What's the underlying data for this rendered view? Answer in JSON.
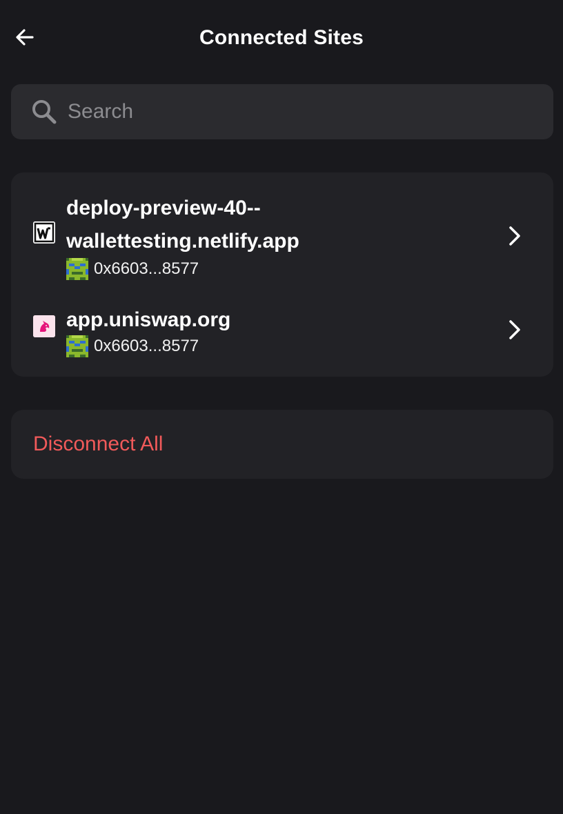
{
  "header": {
    "title": "Connected Sites",
    "back_icon": "arrow-left-icon"
  },
  "search": {
    "placeholder": "Search",
    "value": "",
    "icon": "search-icon"
  },
  "sites": [
    {
      "name": "deploy-preview-40--wallettesting.netlify.app",
      "name_line1": "deploy-preview-40--",
      "name_line2": "wallettesting.netlify.app",
      "favicon": "W",
      "account": "0x6603...8577"
    },
    {
      "name": "app.uniswap.org",
      "favicon": "unicorn-icon",
      "account": "0x6603...8577"
    }
  ],
  "actions": {
    "disconnect_all": "Disconnect All"
  },
  "colors": {
    "background": "#19191d",
    "card": "#222226",
    "search_bg": "#2b2b2f",
    "danger": "#f15a5a",
    "placeholder": "#8c8c90"
  }
}
